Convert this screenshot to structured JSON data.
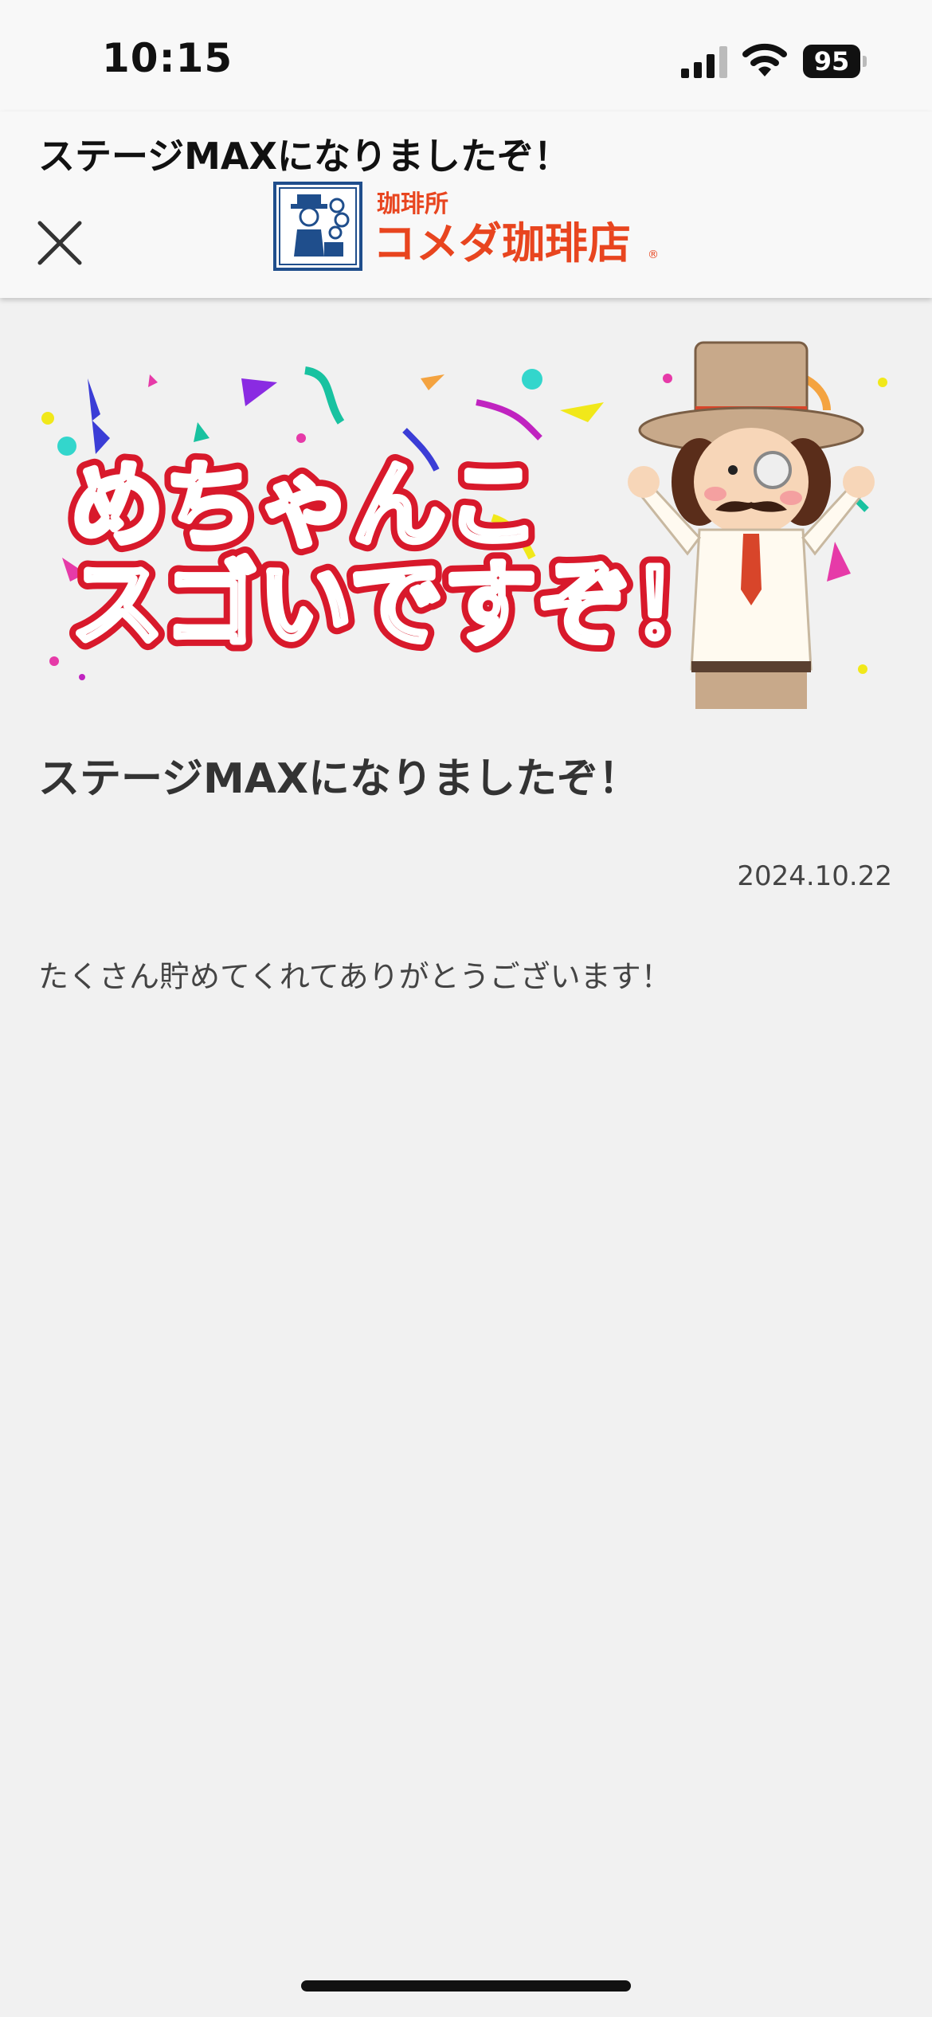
{
  "status_bar": {
    "time": "10:15",
    "battery": "95"
  },
  "header": {
    "title": "ステージMAXになりましたぞ！",
    "logo": {
      "sub_text": "珈琲所",
      "main_text": "コメダ珈琲店",
      "registered_mark": "®"
    }
  },
  "banner": {
    "line1": "めちゃんこ",
    "line2": "スゴいですぞ！"
  },
  "article": {
    "title": "ステージMAXになりましたぞ！",
    "date": "2024.10.22",
    "body": "たくさん貯めてくれてありがとうございます！"
  },
  "colors": {
    "brand_red": "#d8192b",
    "logo_orange": "#e8451f",
    "logo_blue": "#1f4e8c"
  },
  "icons": [
    "signal-icon",
    "wifi-icon",
    "battery-icon",
    "close-icon",
    "mascot-illustration"
  ]
}
